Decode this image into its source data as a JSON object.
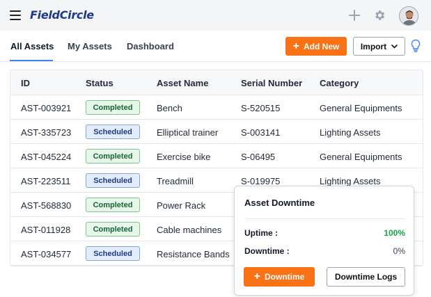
{
  "header": {
    "logo": "FieldCircle",
    "icons": [
      "menu-icon",
      "plus-icon",
      "gear-icon",
      "user-avatar"
    ]
  },
  "tabs": [
    {
      "label": "All Assets",
      "active": true
    },
    {
      "label": "My Assets",
      "active": false
    },
    {
      "label": "Dashboard",
      "active": false
    }
  ],
  "toolbar": {
    "add_label": "Add New",
    "import_label": "Import"
  },
  "table": {
    "columns": [
      "ID",
      "Status",
      "Asset Name",
      "Serial Number",
      "Category"
    ],
    "rows": [
      {
        "id": "AST-003921",
        "status": "Completed",
        "name": "Bench",
        "serial": "S-520515",
        "category": "General Equipments"
      },
      {
        "id": "AST-335723",
        "status": "Scheduled",
        "name": "Elliptical trainer",
        "serial": "S-003141",
        "category": "Lighting Assets"
      },
      {
        "id": "AST-045224",
        "status": "Completed",
        "name": "Exercise bike",
        "serial": "S-06495",
        "category": "General Equipments"
      },
      {
        "id": "AST-223511",
        "status": "Scheduled",
        "name": "Treadmill",
        "serial": "S-019975",
        "category": "Lighting Assets"
      },
      {
        "id": "AST-568830",
        "status": "Completed",
        "name": "Power Rack",
        "serial": "",
        "category": ""
      },
      {
        "id": "AST-011928",
        "status": "Completed",
        "name": "Cable machines",
        "serial": "",
        "category": ""
      },
      {
        "id": "AST-034577",
        "status": "Scheduled",
        "name": "Resistance Bands",
        "serial": "",
        "category": ""
      }
    ]
  },
  "popup": {
    "title": "Asset Downtime",
    "uptime_label": "Uptime :",
    "uptime_value": "100%",
    "downtime_label": "Downtime :",
    "downtime_value": "0%",
    "downtime_button": "Downtime",
    "logs_button": "Downtime Logs"
  },
  "colors": {
    "accent": "#f97316",
    "brand": "#1e3a8a",
    "tab_underline": "#3b82f6",
    "uptime_green": "#16a34a"
  }
}
